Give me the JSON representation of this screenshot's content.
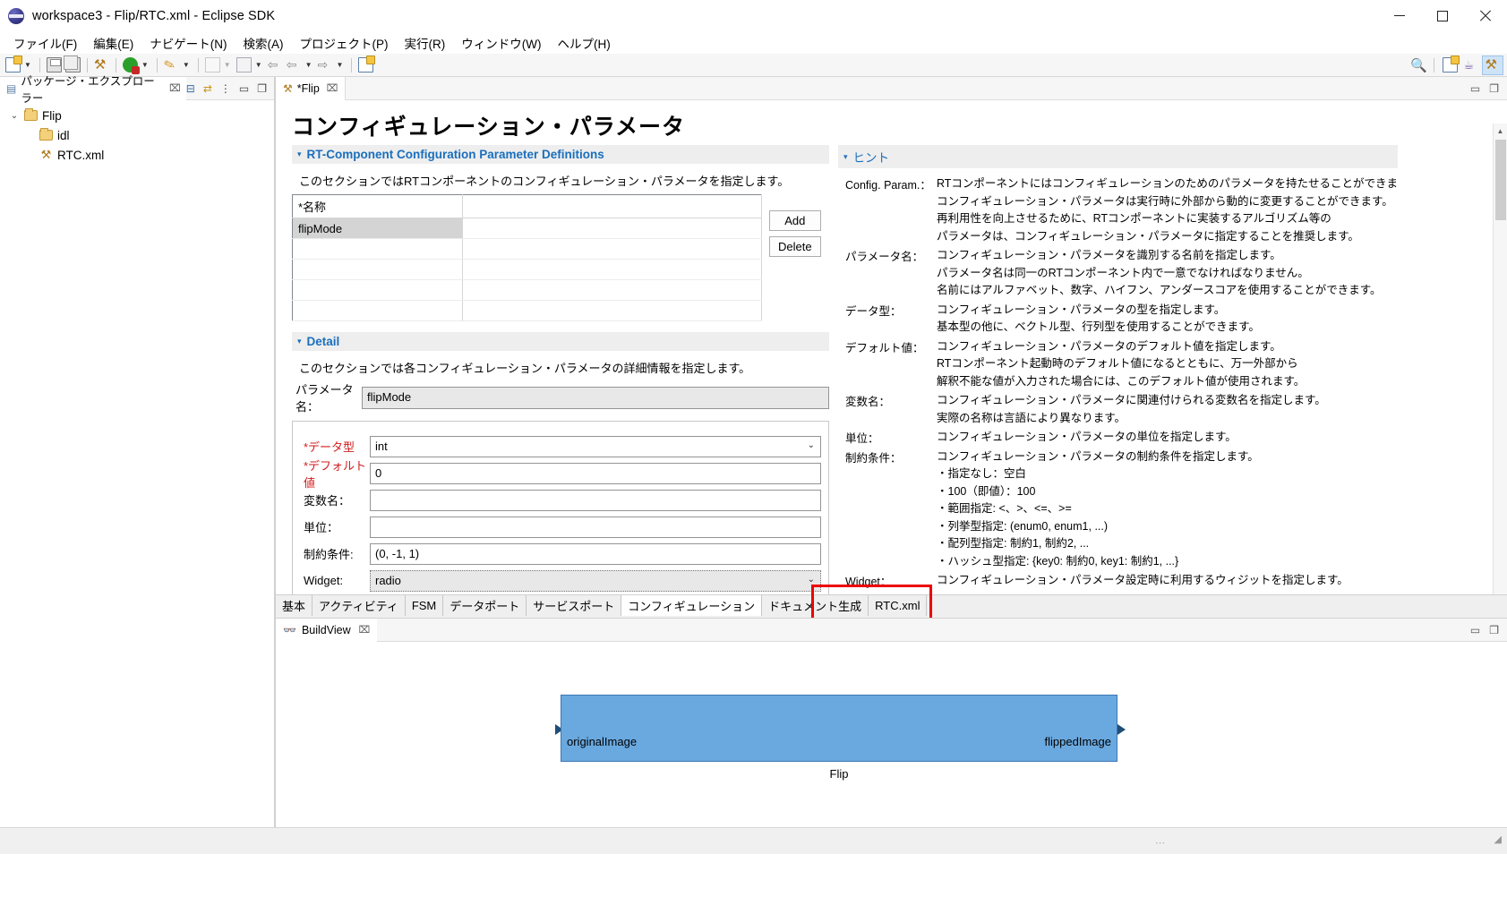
{
  "window": {
    "title": "workspace3 - Flip/RTC.xml - Eclipse SDK",
    "icon": "eclipse-icon",
    "minimize_label": "─",
    "maximize_label": "☐",
    "close_label": "✕"
  },
  "menubar": {
    "items": [
      {
        "label": "ファイル(F)",
        "name": "menu-file"
      },
      {
        "label": "編集(E)",
        "name": "menu-edit"
      },
      {
        "label": "ナビゲート(N)",
        "name": "menu-navigate"
      },
      {
        "label": "検索(A)",
        "name": "menu-search"
      },
      {
        "label": "プロジェクト(P)",
        "name": "menu-project"
      },
      {
        "label": "実行(R)",
        "name": "menu-run"
      },
      {
        "label": "ウィンドウ(W)",
        "name": "menu-window"
      },
      {
        "label": "ヘルプ(H)",
        "name": "menu-help"
      }
    ]
  },
  "toolbar": {
    "icons": [
      "new-document-icon",
      "dropdown-arrow",
      "save-icon",
      "save-all-icon",
      "build-hammer-icon",
      "run-icon",
      "dropdown-arrow",
      "debug-pencil-icon",
      "dropdown-arrow",
      "external-tools-icon",
      "dropdown-arrow",
      "next-annotation-icon",
      "dropdown-arrow",
      "previous-edit-icon",
      "back-icon",
      "dropdown-arrow",
      "forward-icon",
      "dropdown-arrow",
      "new-editor-icon"
    ],
    "right_icons": [
      "search-icon",
      "open-perspective-icon",
      "java-perspective-icon",
      "rtc-perspective-icon"
    ]
  },
  "package_explorer": {
    "tab_label": "パッケージ・エクスプローラー",
    "tab_icon": "package-explorer-icon",
    "close_icon": "⌧",
    "view_icons": [
      "collapse-all-icon",
      "link-with-editor-icon",
      "view-menu-icon",
      "minimize-icon",
      "maximize-icon"
    ],
    "tree": [
      {
        "label": "Flip",
        "icon": "project-folder-icon",
        "twisty": "⌄",
        "indent": 0
      },
      {
        "label": "idl",
        "icon": "folder-icon",
        "twisty": "",
        "indent": 1
      },
      {
        "label": "RTC.xml",
        "icon": "xml-file-icon",
        "twisty": "",
        "indent": 1
      }
    ]
  },
  "editor": {
    "tab_label": "*Flip",
    "tab_icon": "rtc-editor-icon",
    "tab_close": "⌧",
    "view_icons": [
      "minimize-icon",
      "maximize-icon"
    ],
    "page_title": "コンフィギュレーション・パラメータ",
    "definitions_section": {
      "title": "RT-Component Configuration Parameter Definitions",
      "twisty": "▾",
      "description": "このセクションではRTコンポーネントのコンフィギュレーション・パラメータを指定します。",
      "table": {
        "columns": [
          "*名称",
          ""
        ],
        "rows": [
          {
            "name": "flipMode",
            "value": "",
            "selected": true
          },
          {
            "name": "",
            "value": "",
            "selected": false
          },
          {
            "name": "",
            "value": "",
            "selected": false
          },
          {
            "name": "",
            "value": "",
            "selected": false
          },
          {
            "name": "",
            "value": "",
            "selected": false
          }
        ]
      },
      "add_button": "Add",
      "delete_button": "Delete"
    },
    "detail_section": {
      "title": "Detail",
      "twisty": "▾",
      "description": "このセクションでは各コンフィギュレーション・パラメータの詳細情報を指定します。",
      "param_name_label": "パラメータ名：",
      "param_name_value": "flipMode",
      "fields": [
        {
          "label": "*データ型",
          "value": "int",
          "required": true,
          "kind": "combo",
          "name": "data-type-combo"
        },
        {
          "label": "*デフォルト値",
          "value": "0",
          "required": true,
          "kind": "text",
          "name": "default-value-input"
        },
        {
          "label": "変数名：",
          "value": "",
          "required": false,
          "kind": "text",
          "name": "variable-name-input"
        },
        {
          "label": "単位：",
          "value": "",
          "required": false,
          "kind": "text",
          "name": "unit-input"
        },
        {
          "label": "制約条件:",
          "value": "(0, -1, 1)",
          "required": false,
          "kind": "text",
          "name": "constraint-input"
        },
        {
          "label": "Widget:",
          "value": "radio",
          "required": false,
          "kind": "combo-readonly",
          "name": "widget-combo"
        }
      ]
    },
    "hint_section": {
      "title": "ヒント",
      "twisty": "▾",
      "entries": [
        {
          "key": "Config. Param.：",
          "lines": [
            "RTコンポーネントにはコンフィギュレーションのためのパラメータを持たせることができます。",
            "コンフィギュレーション・パラメータは実行時に外部から動的に変更することができます。",
            "再利用性を向上させるために、RTコンポーネントに実装するアルゴリズム等の",
            "パラメータは、コンフィギュレーション・パラメータに指定することを推奨します。"
          ]
        },
        {
          "key": "パラメータ名：",
          "lines": [
            "コンフィギュレーション・パラメータを識別する名前を指定します。",
            "パラメータ名は同一のRTコンポーネント内で一意でなければなりません。",
            "名前にはアルファベット、数字、ハイフン、アンダースコアを使用することができます。"
          ]
        },
        {
          "key": "データ型：",
          "lines": [
            "コンフィギュレーション・パラメータの型を指定します。",
            "基本型の他に、ベクトル型、行列型を使用することができます。"
          ]
        },
        {
          "key": "デフォルト値：",
          "lines": [
            "コンフィギュレーション・パラメータのデフォルト値を指定します。",
            "RTコンポーネント起動時のデフォルト値になるとともに、万一外部から",
            "解釈不能な値が入力された場合には、このデフォルト値が使用されます。"
          ]
        },
        {
          "key": "変数名：",
          "lines": [
            "コンフィギュレーション・パラメータに関連付けられる変数名を指定します。",
            "実際の名称は言語により異なります。"
          ]
        },
        {
          "key": "単位：",
          "lines": [
            "コンフィギュレーション・パラメータの単位を指定します。"
          ]
        },
        {
          "key": "制約条件：",
          "lines": [
            "コンフィギュレーション・パラメータの制約条件を指定します。",
            "・指定なし：空白",
            "・100（即値）：100",
            "・範囲指定: <、>、<=、>=",
            "・列挙型指定: (enum0, enum1, ...)",
            "・配列型指定: 制約1, 制約2, ...",
            "・ハッシュ型指定: {key0: 制約0, key1: 制約1, ...}"
          ]
        },
        {
          "key": "Widget：",
          "lines": [
            "コンフィギュレーション・パラメータ設定時に利用するウィジットを指定します。"
          ]
        }
      ]
    },
    "bottom_tabs": [
      {
        "label": "基本",
        "name": "tab-basic",
        "active": false,
        "highlighted": false
      },
      {
        "label": "アクティビティ",
        "name": "tab-activity",
        "active": false,
        "highlighted": false
      },
      {
        "label": "FSM",
        "name": "tab-fsm",
        "active": false,
        "highlighted": false
      },
      {
        "label": "データポート",
        "name": "tab-dataport",
        "active": false,
        "highlighted": false
      },
      {
        "label": "サービスポート",
        "name": "tab-serviceport",
        "active": false,
        "highlighted": false
      },
      {
        "label": "コンフィギュレーション",
        "name": "tab-configuration",
        "active": true,
        "highlighted": true
      },
      {
        "label": "ドキュメント生成",
        "name": "tab-document",
        "active": false,
        "highlighted": false
      },
      {
        "label": "RTC.xml",
        "name": "tab-rtcxml",
        "active": false,
        "highlighted": false
      }
    ]
  },
  "buildview": {
    "tab_label": "BuildView",
    "tab_icon": "buildview-icon",
    "tab_close": "⌧",
    "view_icons": [
      "minimize-icon",
      "maximize-icon"
    ],
    "component": {
      "name": "Flip",
      "inport_label": "originalImage",
      "outport_label": "flippedImage",
      "fill_color": "#6aa9e0",
      "border_color": "#3c78b5"
    }
  },
  "colors": {
    "section_title": "#1a6fbd",
    "required_label": "#d11c1c",
    "highlight_box": "#ee0000",
    "component_fill": "#6aa9e0"
  }
}
